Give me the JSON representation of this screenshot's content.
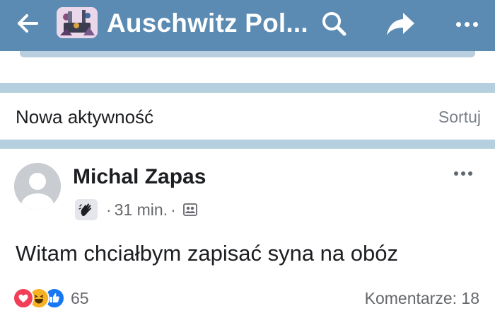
{
  "header": {
    "title": "Auschwitz Pol...",
    "back_icon": "arrow-left-icon",
    "search_icon": "search-icon",
    "share_icon": "share-icon",
    "more_icon": "more-horizontal-icon",
    "bar_color": "#5b8ab2"
  },
  "feed": {
    "section_title": "Nowa aktywność",
    "sort_label": "Sortuj"
  },
  "post": {
    "author": "Michal Zapas",
    "time": "31 min.",
    "meta_separator": "·",
    "badge_icon": "waving-hand-icon",
    "privacy_icon": "group-members-icon",
    "text": "Witam chciałbym zapisać syna na obóz",
    "reactions": {
      "icons": [
        "love",
        "haha",
        "like"
      ],
      "count": "65"
    },
    "comments_label": "Komentarze: 18"
  }
}
